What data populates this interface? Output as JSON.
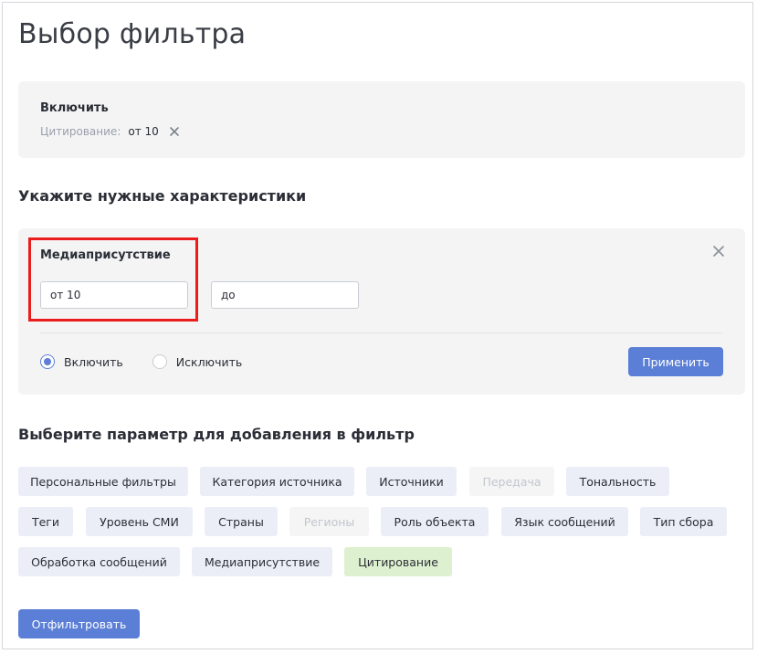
{
  "page": {
    "title": "Выбор фильтра"
  },
  "include": {
    "heading": "Включить",
    "item_label": "Цитирование:",
    "item_value": "от 10"
  },
  "characteristics": {
    "section_title": "Укажите нужные характеристики",
    "category": "Медиаприсутствие",
    "from_value": "от 10",
    "to_placeholder": "до",
    "include_label": "Включить",
    "exclude_label": "Исключить",
    "selected_mode": "include",
    "apply_label": "Применить"
  },
  "params": {
    "section_title": "Выберите параметр для добавления в фильтр",
    "chips": [
      {
        "label": "Персональные фильтры",
        "state": "normal"
      },
      {
        "label": "Категория источника",
        "state": "normal"
      },
      {
        "label": "Источники",
        "state": "normal"
      },
      {
        "label": "Передача",
        "state": "disabled"
      },
      {
        "label": "Тональность",
        "state": "normal"
      },
      {
        "label": "Теги",
        "state": "normal"
      },
      {
        "label": "Уровень СМИ",
        "state": "normal"
      },
      {
        "label": "Страны",
        "state": "normal"
      },
      {
        "label": "Регионы",
        "state": "disabled"
      },
      {
        "label": "Роль объекта",
        "state": "normal"
      },
      {
        "label": "Язык сообщений",
        "state": "normal"
      },
      {
        "label": "Тип сбора",
        "state": "normal"
      },
      {
        "label": "Обработка сообщений",
        "state": "normal"
      },
      {
        "label": "Медиаприсутствие",
        "state": "normal"
      },
      {
        "label": "Цитирование",
        "state": "active"
      }
    ]
  },
  "footer": {
    "filter_label": "Отфильтровать"
  },
  "colors": {
    "accent": "#5b7fd6",
    "chip_bg": "#ebeef7",
    "chip_active_bg": "#ddf0cf",
    "highlight": "#ea1c1c"
  }
}
